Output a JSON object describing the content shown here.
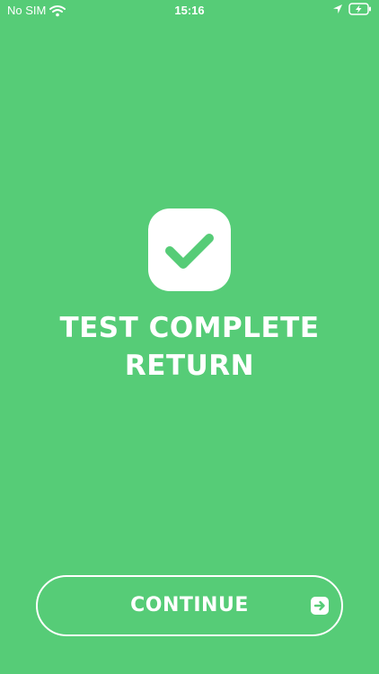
{
  "status_bar": {
    "carrier": "No SIM",
    "time": "15:16"
  },
  "main": {
    "title_line1": "TEST COMPLETE",
    "title_line2": "RETURN",
    "icon": "checkmark-icon"
  },
  "continue_button": {
    "label": "CONTINUE",
    "icon": "arrow-right-icon"
  },
  "colors": {
    "background": "#56cc77",
    "foreground": "#ffffff"
  }
}
